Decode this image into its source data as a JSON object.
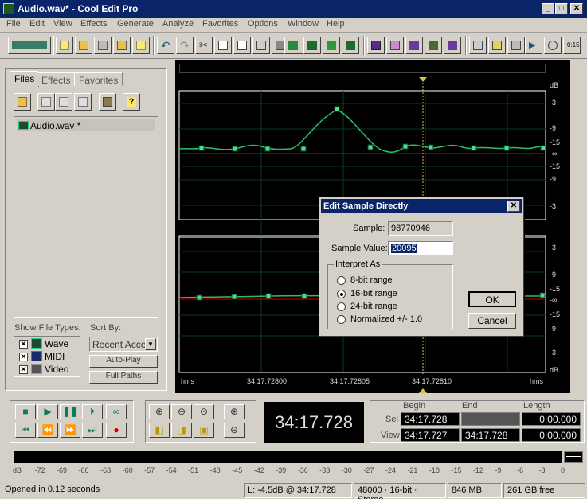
{
  "window": {
    "title": "Audio.wav* - Cool Edit Pro"
  },
  "menu": [
    "File",
    "Edit",
    "View",
    "Effects",
    "Generate",
    "Analyze",
    "Favorites",
    "Options",
    "Window",
    "Help"
  ],
  "left_panel": {
    "tabs": [
      "Files",
      "Effects",
      "Favorites"
    ],
    "files": [
      "Audio.wav *"
    ],
    "show_file_types_label": "Show File Types:",
    "file_types": [
      {
        "label": "Wave",
        "checked": true
      },
      {
        "label": "MIDI",
        "checked": true
      },
      {
        "label": "Video",
        "checked": true
      }
    ],
    "sort_by_label": "Sort By:",
    "sort_value": "Recent Acce",
    "auto_play": "Auto-Play",
    "full_paths": "Full Paths"
  },
  "waveform": {
    "db_labels_top": [
      "dB",
      "-3",
      "-9",
      "-15",
      "-∞",
      "-15",
      "-9",
      "-3"
    ],
    "db_labels_bottom": [
      "-3",
      "-9",
      "-15",
      "-∞",
      "-15",
      "-9",
      "-3",
      "dB"
    ],
    "time_labels": [
      "hms",
      "34:17.72800",
      "34:17.72805",
      "34:17.72810",
      "hms"
    ]
  },
  "transport": {
    "time": "34:17.728",
    "headers": [
      "Begin",
      "End",
      "Length"
    ],
    "sel_label": "Sel",
    "view_label": "View",
    "sel": [
      "34:17.728",
      "",
      "0:00.000"
    ],
    "view": [
      "34:17.727",
      "34:17.728",
      "0:00.000"
    ]
  },
  "meter": {
    "ticks": [
      "dB",
      "-72",
      "-69",
      "-66",
      "-63",
      "-60",
      "-57",
      "-54",
      "-51",
      "-48",
      "-45",
      "-42",
      "-39",
      "-36",
      "-33",
      "-30",
      "-27",
      "-24",
      "-21",
      "-18",
      "-15",
      "-12",
      "-9",
      "-6",
      "-3",
      "0"
    ]
  },
  "status": {
    "message": "Opened in 0.12 seconds",
    "level": "L: -4.5dB @  34:17.728",
    "format": "48000 · 16-bit · Stereo",
    "size": "846 MB",
    "free": "261 GB free"
  },
  "dialog": {
    "title": "Edit Sample Directly",
    "sample_label": "Sample:",
    "sample_value": "98770946",
    "value_label": "Sample Value:",
    "value": "20095",
    "group_label": "Interpret As",
    "options": [
      "8-bit range",
      "16-bit range",
      "24-bit range",
      "Normalized +/- 1.0"
    ],
    "selected_index": 1,
    "ok": "OK",
    "cancel": "Cancel"
  }
}
